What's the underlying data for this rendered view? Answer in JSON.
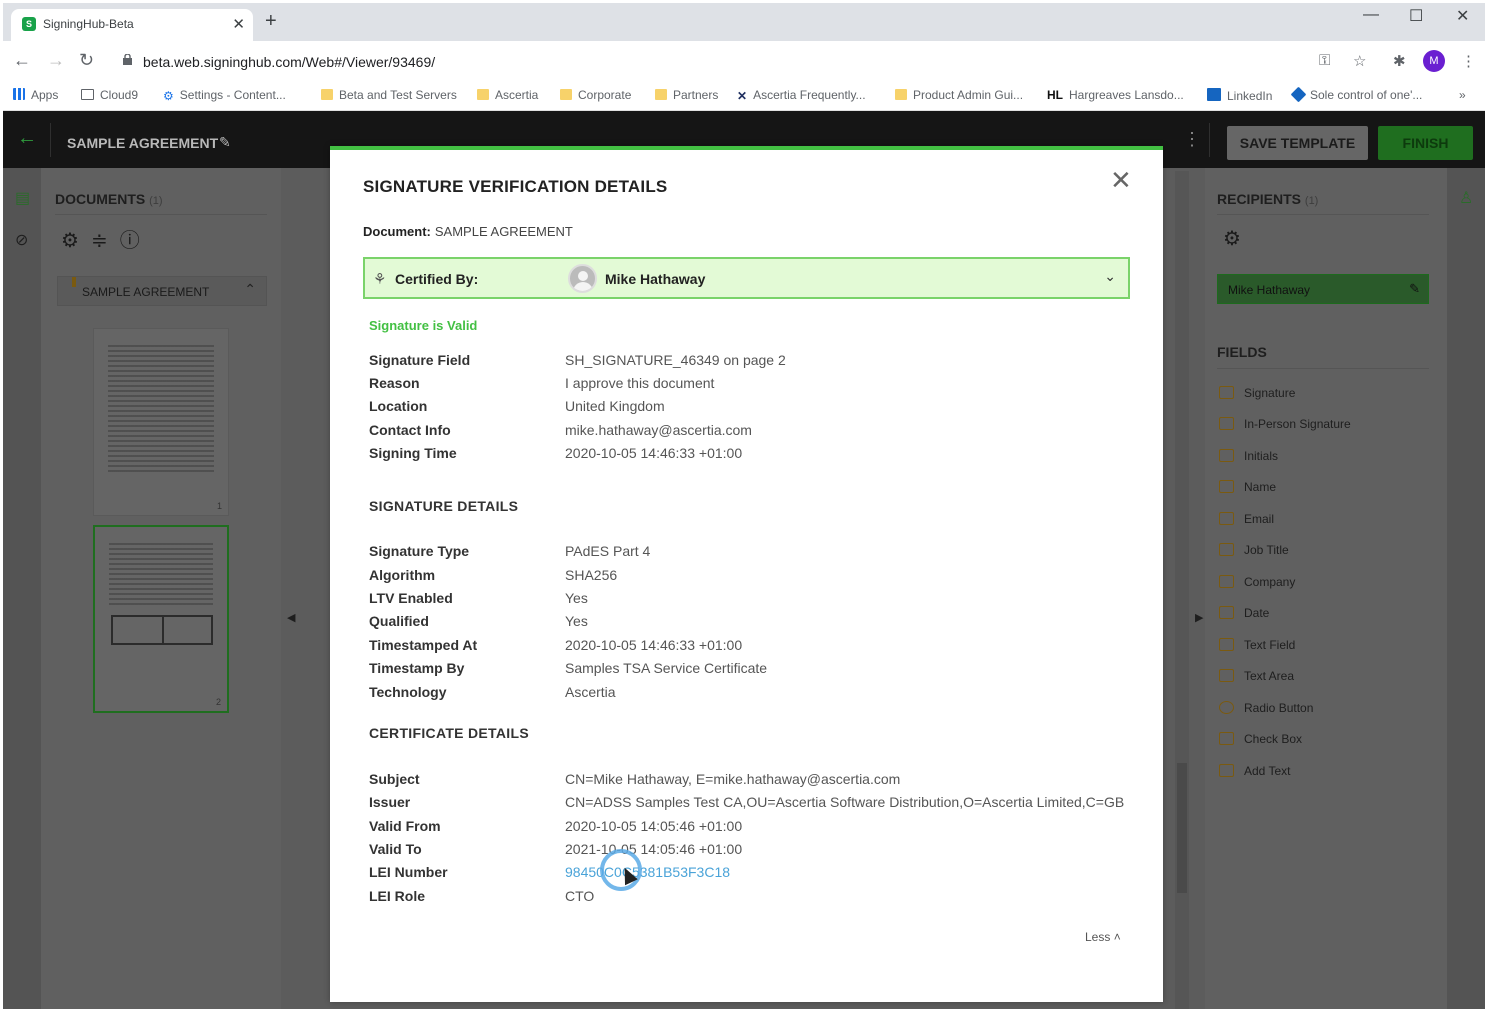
{
  "browser": {
    "tab_title": "SigningHub-Beta",
    "url": "beta.web.signinghub.com/Web#/Viewer/93469/",
    "profile_initial": "M",
    "bookmarks": [
      "Apps",
      "Cloud9",
      "Settings - Content...",
      "Beta and Test Servers",
      "Ascertia",
      "Corporate",
      "Partners",
      "Ascertia Frequently...",
      "Product Admin Gui...",
      "Hargreaves Lansdo...",
      "LinkedIn",
      "Sole control of one'..."
    ],
    "bookmark_hl": "HL"
  },
  "app": {
    "doc_title": "SAMPLE AGREEMENT",
    "save_template": "SAVE TEMPLATE",
    "finish": "FINISH",
    "documents_title": "DOCUMENTS",
    "documents_count": "(1)",
    "document_item": "SAMPLE AGREEMENT",
    "thumb_pages": [
      "1",
      "2"
    ],
    "recipients_title": "RECIPIENTS",
    "recipients_count": "(1)",
    "recipient": "Mike Hathaway",
    "fields_title": "FIELDS",
    "fields": [
      "Signature",
      "In-Person Signature",
      "Initials",
      "Name",
      "Email",
      "Job Title",
      "Company",
      "Date",
      "Text Field",
      "Text Area",
      "Radio Button",
      "Check Box",
      "Add Text"
    ]
  },
  "modal": {
    "title": "SIGNATURE VERIFICATION DETAILS",
    "doc_label": "Document:",
    "doc_value": "SAMPLE AGREEMENT",
    "certified_label": "Certified By:",
    "certified_name": "Mike Hathaway",
    "valid_text": "Signature is Valid",
    "general": [
      {
        "k": "Signature Field",
        "v": "SH_SIGNATURE_46349 on page 2"
      },
      {
        "k": "Reason",
        "v": "I approve this document"
      },
      {
        "k": "Location",
        "v": "United Kingdom"
      },
      {
        "k": "Contact Info",
        "v": "mike.hathaway@ascertia.com"
      },
      {
        "k": "Signing Time",
        "v": "2020-10-05 14:46:33 +01:00"
      }
    ],
    "sig_header": "SIGNATURE DETAILS",
    "sig": [
      {
        "k": "Signature Type",
        "v": "PAdES Part 4"
      },
      {
        "k": "Algorithm",
        "v": "SHA256"
      },
      {
        "k": "LTV Enabled",
        "v": "Yes"
      },
      {
        "k": "Qualified",
        "v": "Yes"
      },
      {
        "k": "Timestamped At",
        "v": "2020-10-05 14:46:33 +01:00"
      },
      {
        "k": "Timestamp By",
        "v": "Samples TSA Service Certificate"
      },
      {
        "k": "Technology",
        "v": "Ascertia"
      }
    ],
    "cert_header": "CERTIFICATE DETAILS",
    "cert": [
      {
        "k": "Subject",
        "v": "CN=Mike Hathaway, E=mike.hathaway@ascertia.com"
      },
      {
        "k": "Issuer",
        "v": "CN=ADSS Samples Test CA,OU=Ascertia Software Distribution,O=Ascertia Limited,C=GB"
      },
      {
        "k": "Valid From",
        "v": "2020-10-05 14:05:46 +01:00"
      },
      {
        "k": "Valid To",
        "v": "2021-10-05 14:05:46 +01:00"
      },
      {
        "k": "LEI Number",
        "v": "98450C0C5381B53F3C18"
      },
      {
        "k": "LEI Role",
        "v": "CTO"
      }
    ],
    "less": "Less"
  }
}
